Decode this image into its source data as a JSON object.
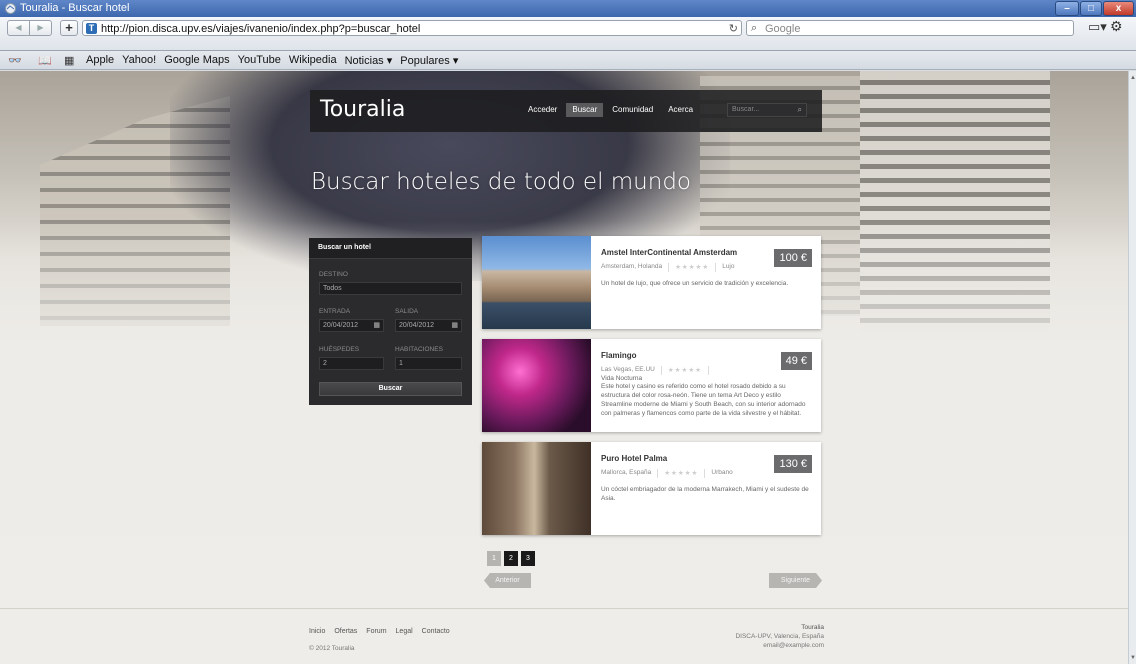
{
  "window": {
    "title": "Touralia - Buscar hotel",
    "min": "–",
    "max": "□",
    "close": "x"
  },
  "toolbar": {
    "url": "http://pion.disca.upv.es/viajes/ivanenio/index.php?p=buscar_hotel",
    "search_placeholder": "Google",
    "back": "◀",
    "forward": "▶",
    "add": "+",
    "reload": "↻"
  },
  "bookmarks": [
    "Apple",
    "Yahoo!",
    "Google Maps",
    "YouTube",
    "Wikipedia",
    "Noticias ▾",
    "Populares ▾"
  ],
  "site": {
    "brand": "Touralia",
    "nav": [
      "Acceder",
      "Buscar",
      "Comunidad",
      "Acerca"
    ],
    "search_placeholder": "Buscar...",
    "headline": "Buscar hoteles de todo el mundo"
  },
  "panel": {
    "title": "Buscar un hotel",
    "destino_label": "DESTINO",
    "destino_value": "Todos",
    "entrada_label": "ENTRADA",
    "entrada_value": "20/04/2012",
    "salida_label": "SALIDA",
    "salida_value": "20/04/2012",
    "huespedes_label": "HUÉSPEDES",
    "huespedes_value": "2",
    "habitaciones_label": "HABITACIONES",
    "habitaciones_value": "1",
    "button": "Buscar"
  },
  "hotels": [
    {
      "name": "Amstel InterContinental Amsterdam",
      "location": "Amsterdam, Holanda",
      "stars": "★★★★★",
      "category": "Lujo",
      "price": "100 €",
      "description": "Un hotel de lujo, que ofrece un servicio de tradición y excelencia."
    },
    {
      "name": "Flamingo",
      "location": "Las Vegas, EE.UU",
      "stars": "★★★★★",
      "category": "Vida Nocturna",
      "price": "49 €",
      "description": "Este hotel y casino es referido como el hotel rosado debido a su estructura del color rosa-neón. Tiene un tema Art Deco y estilo Streamline moderne de Miami y South Beach, con su interior adornado con palmeras y flamencos como parte de la vida silvestre y el hábitat."
    },
    {
      "name": "Puro Hotel Palma",
      "location": "Mallorca, España",
      "stars": "★★★★★",
      "category": "Urbano",
      "price": "130 €",
      "description": "Un cóctel embriagador de la moderna Marrakech, Miami y el sudeste de Asia."
    }
  ],
  "pager": {
    "pages": [
      "1",
      "2",
      "3"
    ],
    "prev": "Anterior",
    "next": "Siguiente"
  },
  "footer": {
    "links": [
      "Inicio",
      "Ofertas",
      "Forum",
      "Legal",
      "Contacto"
    ],
    "copyright": "© 2012 Touralia",
    "brand": "Touralia",
    "address": "DISCA-UPV, Valencia, España",
    "email": "email@example.com"
  }
}
